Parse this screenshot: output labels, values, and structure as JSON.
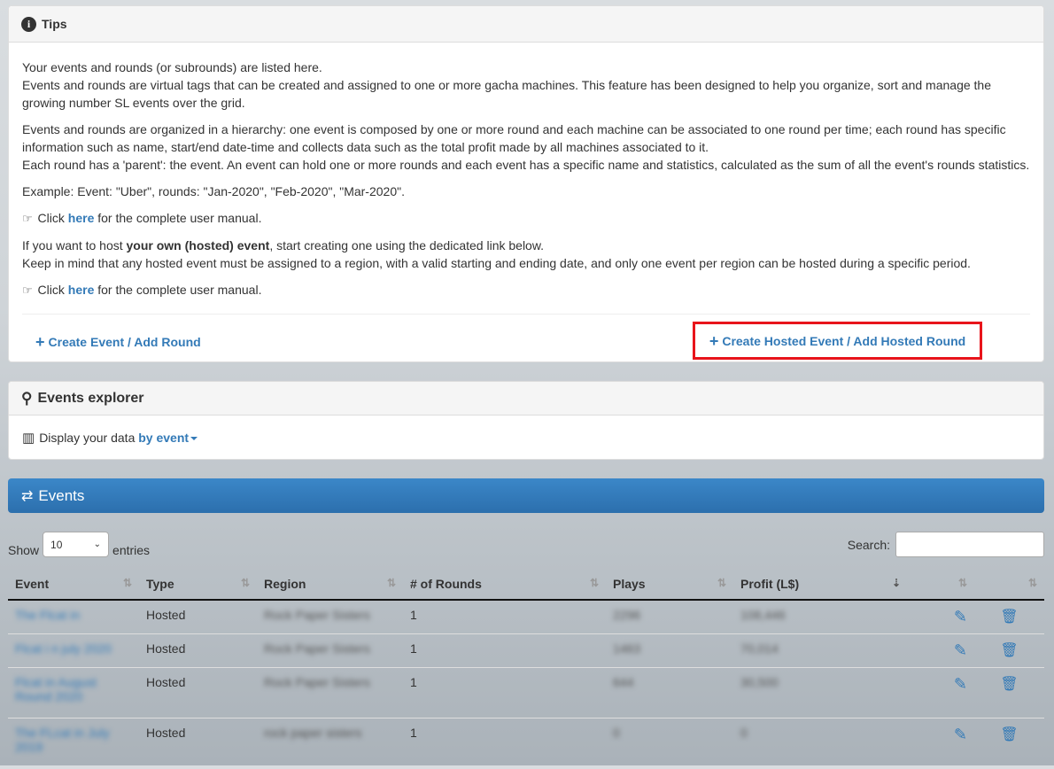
{
  "tips": {
    "title": "Tips",
    "p1a": "Your events and rounds (or subrounds) are listed here.",
    "p1b": "Events and rounds are virtual tags that can be created and assigned to one or more gacha machines. This feature has been designed to help you organize, sort and manage the growing number SL events over the grid.",
    "p2a": "Events and rounds are organized in a hierarchy: one event is composed by one or more round and each machine can be associated to one round per time; each round has specific information such as name, start/end date-time and collects data such as the total profit made by all machines associated to it.",
    "p2b": "Each round has a 'parent': the event. An event can hold one or more rounds and each event has a specific name and statistics, calculated as the sum of all the event's rounds statistics.",
    "p3": "Example: Event: \"Uber\", rounds: \"Jan-2020\", \"Feb-2020\", \"Mar-2020\".",
    "click": "Click",
    "here": "here",
    "manual_suffix": "for the complete user manual.",
    "p5_prefix": "If you want to host",
    "p5_bold": "your own (hosted) event",
    "p5_suffix": ", start creating one using the dedicated link below.",
    "p5b": "Keep in mind that any hosted event must be assigned to a region, with a valid starting and ending date, and only one event per region can be hosted during a specific period.",
    "create_event": "Create Event / Add Round",
    "create_hosted": "Create Hosted Event / Add Hosted Round"
  },
  "explorer": {
    "title": "Events explorer",
    "display_label": "Display your data",
    "display_value": "by event"
  },
  "events": {
    "title": "Events",
    "show_label": "Show",
    "entries_value": "10",
    "entries_label": "entries",
    "search_label": "Search:",
    "columns": [
      "Event",
      "Type",
      "Region",
      "# of Rounds",
      "Plays",
      "Profit (L$)"
    ],
    "rows": [
      {
        "event": "The Flcat in",
        "type": "Hosted",
        "region": "Rock Paper Sisters",
        "rounds": "1",
        "plays": "2296",
        "profit": "108,446"
      },
      {
        "event": "Flcat i n july 2020",
        "type": "Hosted",
        "region": "Rock Paper Sisters",
        "rounds": "1",
        "plays": "1463",
        "profit": "70,014"
      },
      {
        "event": "Flcat in August Round 2020",
        "type": "Hosted",
        "region": "Rock Paper Sisters",
        "rounds": "1",
        "plays": "644",
        "profit": "30,500"
      },
      {
        "event": "The FLcat in July 2019",
        "type": "Hosted",
        "region": "rock paper sisters",
        "rounds": "1",
        "plays": "0",
        "profit": "0"
      }
    ]
  }
}
